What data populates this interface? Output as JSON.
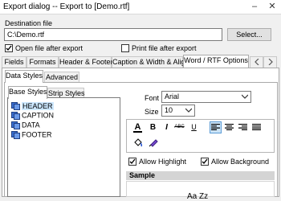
{
  "window": {
    "title": "Export dialog -- Export to [Demo.rtf]",
    "minimize_label": "–",
    "close_label": "✕"
  },
  "destination": {
    "label": "Destination file",
    "value": "C:\\Demo.rtf",
    "select_label": "Select..."
  },
  "options": {
    "open_after_label": "Open file after export",
    "open_after_checked": true,
    "print_after_label": "Print file after export",
    "print_after_checked": false
  },
  "main_tabs": [
    "Fields",
    "Formats",
    "Header & Footer",
    "Caption & Width & Align",
    "Word / RTF Options"
  ],
  "main_tab_active": "Word / RTF Options",
  "sub_tabs": [
    "Data Styles",
    "Advanced"
  ],
  "sub_tab_active": "Data Styles",
  "style_tabs": [
    "Base Styles",
    "Strip Styles"
  ],
  "style_tab_active": "Base Styles",
  "styles": [
    "HEADER",
    "CAPTION",
    "DATA",
    "FOOTER"
  ],
  "style_selected": "HEADER",
  "font": {
    "font_label": "Font",
    "font_value": "Arial",
    "size_label": "Size",
    "size_value": "10",
    "color_glyph": "A",
    "bold_glyph": "B",
    "italic_glyph": "I",
    "strike_glyph": "ABC",
    "underline_glyph": "U"
  },
  "allow_highlight": {
    "label": "Allow Highlight",
    "checked": true
  },
  "allow_background": {
    "label": "Allow Background",
    "checked": true
  },
  "sample": {
    "header": "Sample",
    "text": "Aa Zz"
  }
}
